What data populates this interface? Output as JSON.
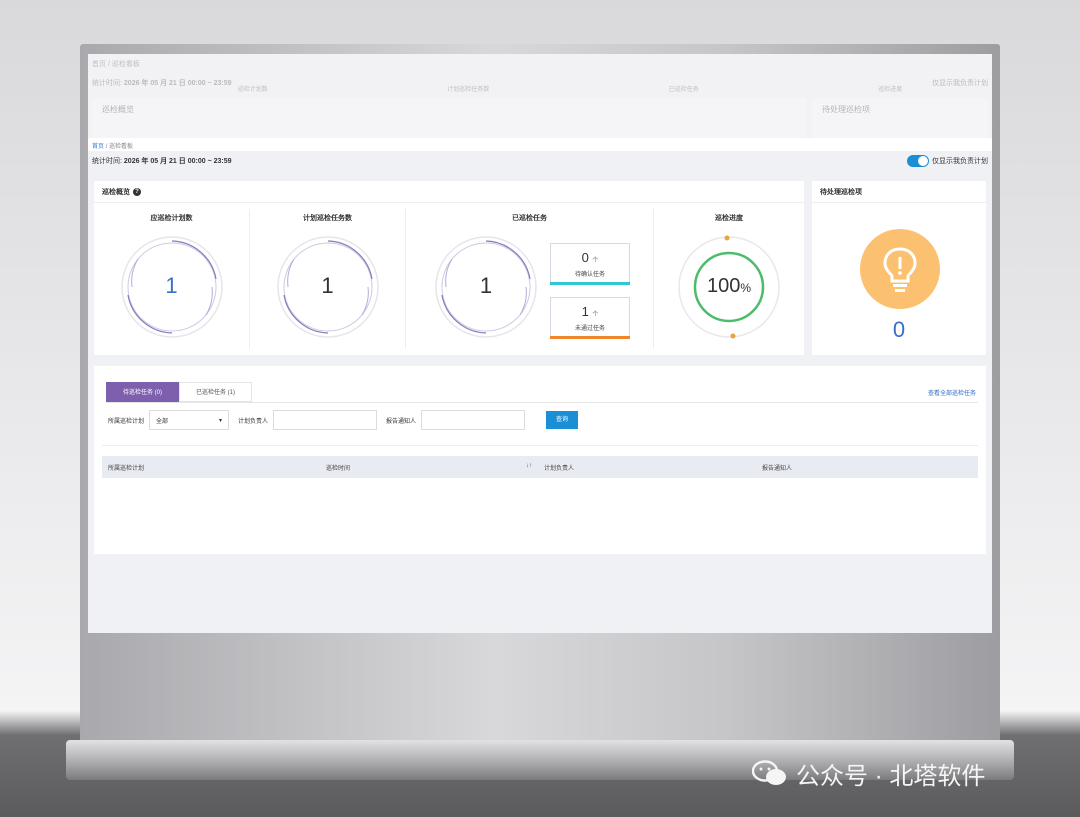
{
  "ghost": {
    "breadcrumb": "首页 / 巡检看板",
    "stat_label": "统计时间:",
    "stat_value": "2026 年 05 月 21 日 00:00 ~ 23:59",
    "toggle_label": "仅显示我负责计划",
    "panel_title": "巡检概览",
    "panel2_title": "待处理巡检项",
    "subtitles": [
      "巡检计划数",
      "计划巡检任务数",
      "已巡检任务",
      "巡检进度"
    ]
  },
  "breadcrumb": {
    "home": "首页",
    "sep": "/",
    "current": "巡检看板"
  },
  "stats": {
    "label": "统计时间:",
    "value": "2026 年 05 月 21 日 00:00 ~ 23:59",
    "toggle_label": "仅显示我负责计划",
    "toggle_on": true
  },
  "overview": {
    "title": "巡检概览",
    "metrics": [
      {
        "title": "应巡检计划数",
        "value": "1"
      },
      {
        "title": "计划巡检任务数",
        "value": "1"
      },
      {
        "title": "已巡检任务",
        "value": "1"
      },
      {
        "title": "巡检进度",
        "value": "100",
        "unit": "%",
        "progress": 1.0
      }
    ],
    "mini_cards": [
      {
        "value": "0",
        "unit": "个",
        "label": "待确认任务",
        "color": "#2ec7d6"
      },
      {
        "value": "1",
        "unit": "个",
        "label": "未通过任务",
        "color": "#f0862a"
      }
    ]
  },
  "pending": {
    "title": "待处理巡检项",
    "value": "0",
    "icon": "lightbulb-icon"
  },
  "tabs": [
    {
      "label": "待巡检任务 (0)",
      "active": true
    },
    {
      "label": "已巡检任务 (1)",
      "active": false
    }
  ],
  "view_all": "查看全部巡检任务",
  "filters": {
    "plan_label": "所属巡检计划",
    "plan_value": "全部",
    "owner_label": "计划负责人",
    "owner_value": "",
    "notify_label": "报告通知人",
    "notify_value": "",
    "query_button": "查询"
  },
  "table": {
    "columns": [
      "所属巡检计划",
      "巡检时间",
      "计划负责人",
      "报告通知人"
    ]
  },
  "watermark": {
    "text": "公众号 · 北塔软件",
    "icon": "wechat-icon"
  },
  "colors": {
    "accent": "#1a8fd6",
    "tab_active": "#7d5fad",
    "bulb": "#fcc170",
    "progress": "#4cbb6c"
  }
}
